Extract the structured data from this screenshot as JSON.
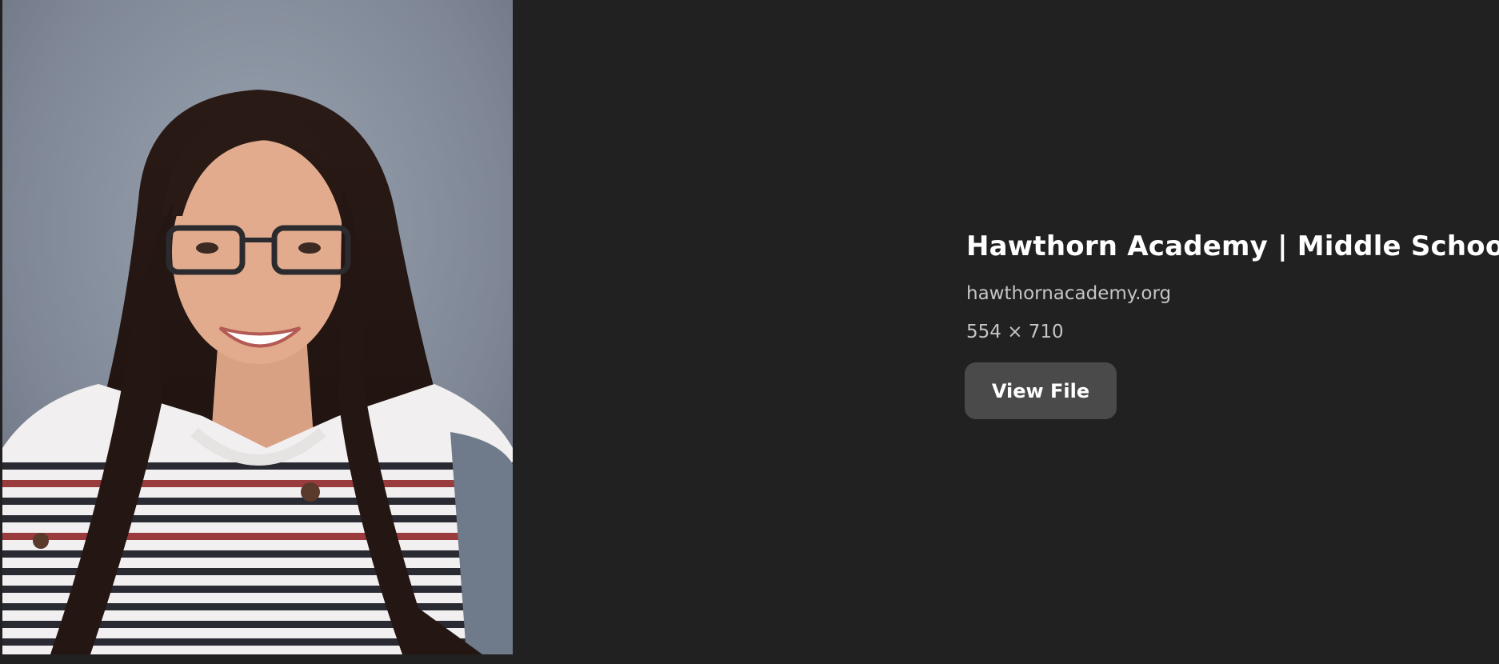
{
  "image_result": {
    "title": "Hawthorn Academy | Middle School",
    "source": "hawthornacademy.org",
    "dimensions": "554 × 710",
    "view_file_label": "View File"
  },
  "colors": {
    "background": "#212121",
    "button_background": "#4a4a4a",
    "title_text": "#ffffff",
    "meta_text": "#c5c5c5"
  }
}
